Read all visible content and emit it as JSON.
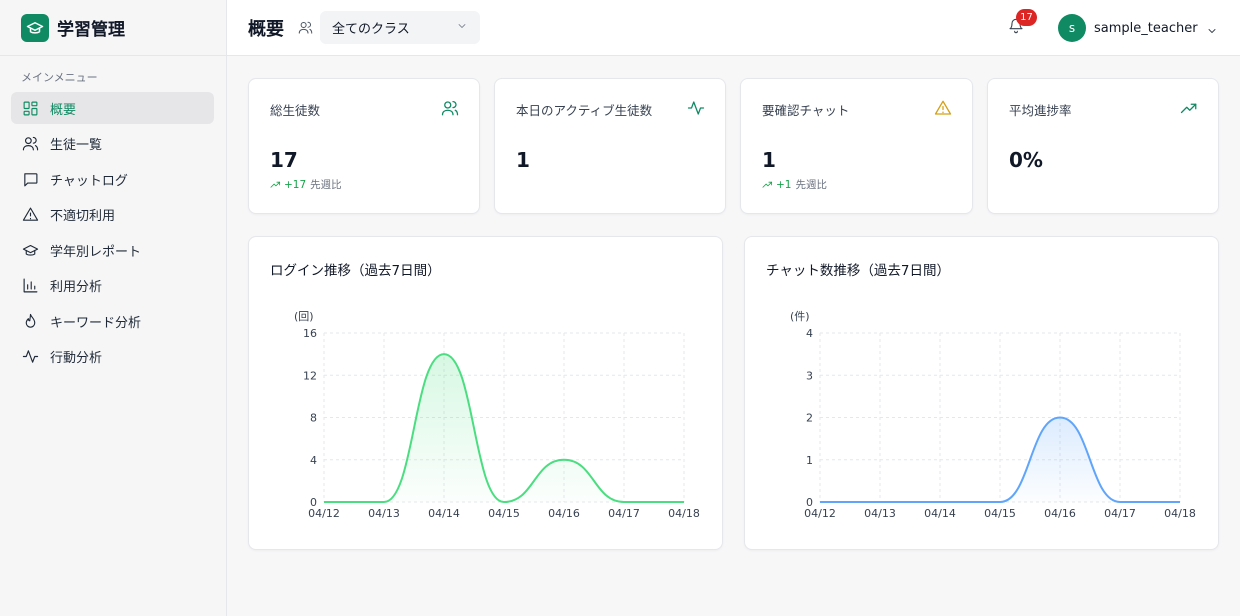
{
  "app": {
    "title": "学習管理"
  },
  "sidebar": {
    "heading": "メインメニュー",
    "items": [
      {
        "label": "概要",
        "icon": "dashboard-icon",
        "active": true
      },
      {
        "label": "生徒一覧",
        "icon": "users-icon",
        "active": false
      },
      {
        "label": "チャットログ",
        "icon": "chat-icon",
        "active": false
      },
      {
        "label": "不適切利用",
        "icon": "warning-icon",
        "active": false
      },
      {
        "label": "学年別レポート",
        "icon": "graduation-cap-icon",
        "active": false
      },
      {
        "label": "利用分析",
        "icon": "bar-chart-icon",
        "active": false
      },
      {
        "label": "キーワード分析",
        "icon": "flame-icon",
        "active": false
      },
      {
        "label": "行動分析",
        "icon": "activity-icon",
        "active": false
      }
    ]
  },
  "header": {
    "title": "概要",
    "class_select": "全てのクラス",
    "notification_count": "17",
    "user_initial": "s",
    "username": "sample_teacher"
  },
  "stats": [
    {
      "title": "総生徒数",
      "value": "17",
      "delta": "+17",
      "delta_label": "先週比",
      "icon": "users-icon",
      "icon_color": "#0f8a63"
    },
    {
      "title": "本日のアクティブ生徒数",
      "value": "1",
      "delta": "",
      "delta_label": "",
      "icon": "activity-icon",
      "icon_color": "#0f8a63"
    },
    {
      "title": "要確認チャット",
      "value": "1",
      "delta": "+1",
      "delta_label": "先週比",
      "icon": "warning-icon",
      "icon_color": "#d4a017"
    },
    {
      "title": "平均進捗率",
      "value": "0%",
      "delta": "",
      "delta_label": "",
      "icon": "trending-up-icon",
      "icon_color": "#0f8a63"
    }
  ],
  "charts": {
    "login_title": "ログイン推移（過去7日間）",
    "chat_title": "チャット数推移（過去7日間）"
  },
  "chart_data": [
    {
      "type": "area",
      "title": "ログイン推移（過去7日間）",
      "ylabel": "(回)",
      "categories": [
        "04/12",
        "04/13",
        "04/14",
        "04/15",
        "04/16",
        "04/17",
        "04/18"
      ],
      "values": [
        0,
        0,
        14,
        0,
        4,
        0,
        0
      ],
      "yticks": [
        0,
        4,
        8,
        12,
        16
      ],
      "ylim": [
        0,
        16
      ],
      "grid": true,
      "color": "#4ade80"
    },
    {
      "type": "area",
      "title": "チャット数推移（過去7日間）",
      "ylabel": "(件)",
      "categories": [
        "04/12",
        "04/13",
        "04/14",
        "04/15",
        "04/16",
        "04/17",
        "04/18"
      ],
      "values": [
        0,
        0,
        0,
        0,
        2,
        0,
        0
      ],
      "yticks": [
        0,
        1,
        2,
        3,
        4
      ],
      "ylim": [
        0,
        4
      ],
      "grid": true,
      "color": "#60a5fa"
    }
  ]
}
